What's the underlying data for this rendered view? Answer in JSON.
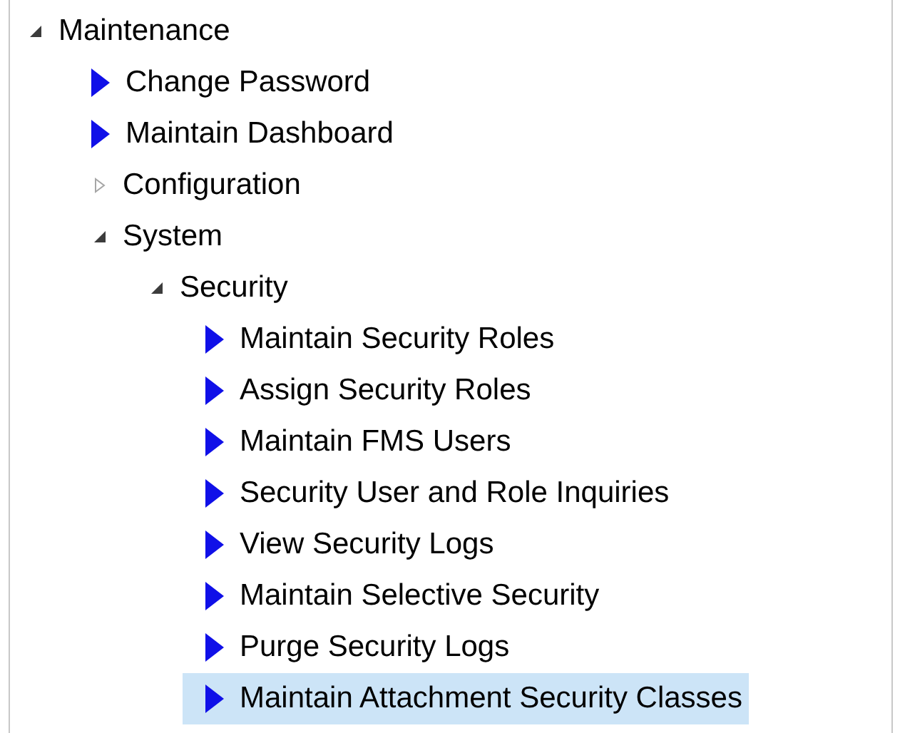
{
  "tree": [
    {
      "label": "Maintenance",
      "kind": "folder",
      "expanded": true,
      "selected": false,
      "children": [
        {
          "label": "Change Password",
          "kind": "leaf",
          "selected": false
        },
        {
          "label": "Maintain Dashboard",
          "kind": "leaf",
          "selected": false
        },
        {
          "label": "Configuration",
          "kind": "folder",
          "expanded": false,
          "selected": false
        },
        {
          "label": "System",
          "kind": "folder",
          "expanded": true,
          "selected": false,
          "children": [
            {
              "label": "Security",
              "kind": "folder",
              "expanded": true,
              "selected": false,
              "children": [
                {
                  "label": "Maintain Security Roles",
                  "kind": "leaf",
                  "selected": false
                },
                {
                  "label": "Assign Security Roles",
                  "kind": "leaf",
                  "selected": false
                },
                {
                  "label": "Maintain FMS Users",
                  "kind": "leaf",
                  "selected": false
                },
                {
                  "label": "Security User and Role Inquiries",
                  "kind": "leaf",
                  "selected": false
                },
                {
                  "label": "View Security Logs",
                  "kind": "leaf",
                  "selected": false
                },
                {
                  "label": "Maintain Selective Security",
                  "kind": "leaf",
                  "selected": false
                },
                {
                  "label": "Purge Security Logs",
                  "kind": "leaf",
                  "selected": false
                },
                {
                  "label": "Maintain Attachment Security Classes",
                  "kind": "leaf",
                  "selected": true
                }
              ]
            }
          ]
        }
      ]
    }
  ]
}
